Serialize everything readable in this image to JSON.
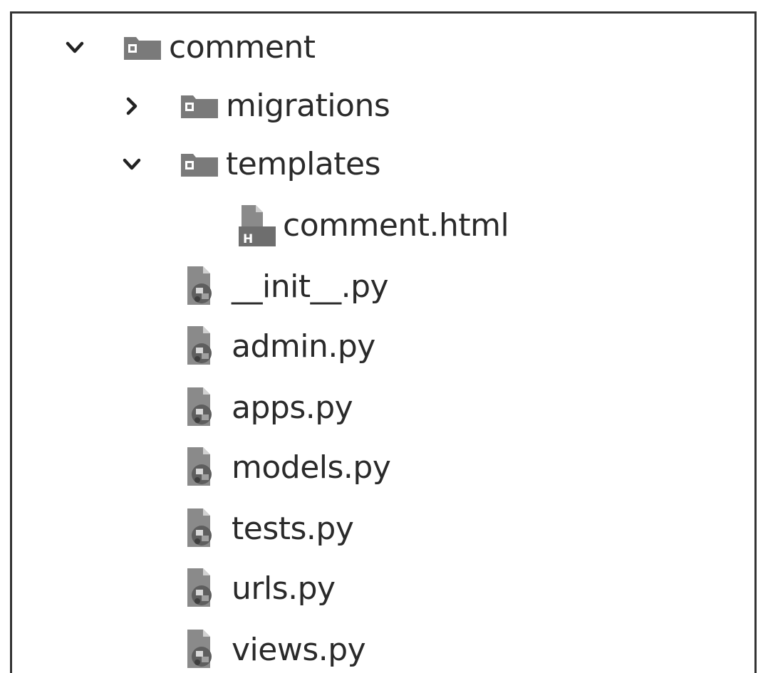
{
  "tree": {
    "root": {
      "label": "comment",
      "expanded": true,
      "icon": "folder-icon"
    },
    "folders": [
      {
        "label": "migrations",
        "expanded": false,
        "icon": "folder-icon"
      },
      {
        "label": "templates",
        "expanded": true,
        "icon": "folder-icon"
      }
    ],
    "template_files": [
      {
        "label": "comment.html",
        "icon": "html-file-icon"
      }
    ],
    "python_files": [
      {
        "label": "__init__.py",
        "icon": "python-file-icon"
      },
      {
        "label": "admin.py",
        "icon": "python-file-icon"
      },
      {
        "label": "apps.py",
        "icon": "python-file-icon"
      },
      {
        "label": "models.py",
        "icon": "python-file-icon"
      },
      {
        "label": "tests.py",
        "icon": "python-file-icon"
      },
      {
        "label": "urls.py",
        "icon": "python-file-icon"
      },
      {
        "label": "views.py",
        "icon": "python-file-icon"
      }
    ]
  }
}
